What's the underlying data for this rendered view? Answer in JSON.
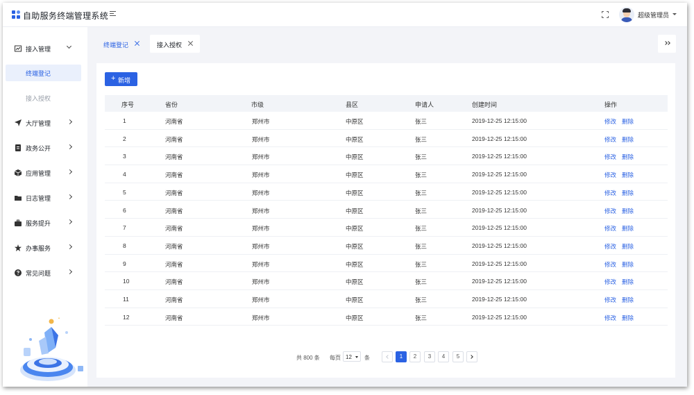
{
  "app": {
    "title": "自助服务终端管理系统",
    "user_name": "超级管理员",
    "accent_color": "#2b62e3"
  },
  "sidebar": {
    "items": [
      {
        "label": "接入管理",
        "icon": "chart-icon",
        "expanded": true,
        "children": [
          {
            "label": "终端登记",
            "active": true
          },
          {
            "label": "接入授权",
            "active": false
          }
        ]
      },
      {
        "label": "大厅管理",
        "icon": "send-icon"
      },
      {
        "label": "政务公开",
        "icon": "document-icon"
      },
      {
        "label": "应用管理",
        "icon": "cube-icon"
      },
      {
        "label": "日志管理",
        "icon": "folder-icon"
      },
      {
        "label": "服务提升",
        "icon": "briefcase-icon"
      },
      {
        "label": "办事服务",
        "icon": "star-icon"
      },
      {
        "label": "常见问题",
        "icon": "question-icon"
      }
    ]
  },
  "tabs": [
    {
      "label": "终端登记",
      "active": true
    },
    {
      "label": "接入授权",
      "active": false
    }
  ],
  "toolbar": {
    "add_label": "新增",
    "add_icon": "+"
  },
  "table": {
    "columns": [
      "序号",
      "省份",
      "市级",
      "县区",
      "申请人",
      "创建时间",
      "操作"
    ],
    "rows": [
      {
        "no": "1",
        "province": "河南省",
        "city": "郑州市",
        "county": "中原区",
        "applicant": "张三",
        "created": "2019-12-25 12:15:00"
      },
      {
        "no": "2",
        "province": "河南省",
        "city": "郑州市",
        "county": "中原区",
        "applicant": "张三",
        "created": "2019-12-25 12:15:00"
      },
      {
        "no": "3",
        "province": "河南省",
        "city": "郑州市",
        "county": "中原区",
        "applicant": "张三",
        "created": "2019-12-25 12:15:00"
      },
      {
        "no": "4",
        "province": "河南省",
        "city": "郑州市",
        "county": "中原区",
        "applicant": "张三",
        "created": "2019-12-25 12:15:00"
      },
      {
        "no": "5",
        "province": "河南省",
        "city": "郑州市",
        "county": "中原区",
        "applicant": "张三",
        "created": "2019-12-25 12:15:00"
      },
      {
        "no": "6",
        "province": "河南省",
        "city": "郑州市",
        "county": "中原区",
        "applicant": "张三",
        "created": "2019-12-25 12:15:00"
      },
      {
        "no": "7",
        "province": "河南省",
        "city": "郑州市",
        "county": "中原区",
        "applicant": "张三",
        "created": "2019-12-25 12:15:00"
      },
      {
        "no": "8",
        "province": "河南省",
        "city": "郑州市",
        "county": "中原区",
        "applicant": "张三",
        "created": "2019-12-25 12:15:00"
      },
      {
        "no": "9",
        "province": "河南省",
        "city": "郑州市",
        "county": "中原区",
        "applicant": "张三",
        "created": "2019-12-25 12:15:00"
      },
      {
        "no": "10",
        "province": "河南省",
        "city": "郑州市",
        "county": "中原区",
        "applicant": "张三",
        "created": "2019-12-25 12:15:00"
      },
      {
        "no": "11",
        "province": "河南省",
        "city": "郑州市",
        "county": "中原区",
        "applicant": "张三",
        "created": "2019-12-25 12:15:00"
      },
      {
        "no": "12",
        "province": "河南省",
        "city": "郑州市",
        "county": "中原区",
        "applicant": "张三",
        "created": "2019-12-25 12:15:00"
      }
    ],
    "edit_label": "修改",
    "delete_label": "删除"
  },
  "pagination": {
    "total_text": "共 800 条",
    "per_page_label": "每页",
    "per_page_value": "12",
    "unit_label": "条",
    "pages": [
      "1",
      "2",
      "3",
      "4",
      "5"
    ],
    "current_page": "1"
  }
}
